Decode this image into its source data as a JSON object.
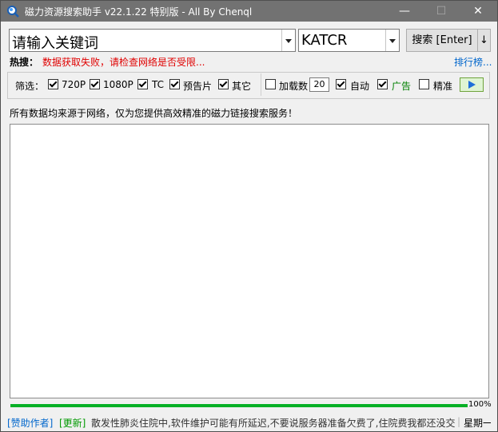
{
  "window": {
    "title": "磁力资源搜索助手 v22.1.22 特别版 - All By Chenql",
    "minimize": "—",
    "maximize": "☐",
    "close": "✕"
  },
  "search": {
    "keyword_placeholder": "请输入关键词",
    "engine": "KATCR",
    "search_button": "搜索 [Enter]",
    "sort_button": "↓"
  },
  "hot": {
    "label": "热搜：",
    "error": "数据获取失败，请检查网络是否受限...",
    "rank_link": "排行榜..."
  },
  "filter": {
    "label": "筛选：",
    "options": [
      {
        "label": "720P",
        "checked": true
      },
      {
        "label": "1080P",
        "checked": true
      },
      {
        "label": "TC",
        "checked": true
      },
      {
        "label": "预告片",
        "checked": true
      },
      {
        "label": "其它",
        "checked": true
      }
    ],
    "load_count_label": "加载数",
    "load_count_checked": false,
    "load_count_value": "20",
    "auto_label": "自动",
    "auto_checked": true,
    "ads_label": "广告",
    "ads_checked": true,
    "ads_color": "#008000",
    "precise_label": "精准",
    "precise_checked": false,
    "play_icon": "play-icon"
  },
  "notice": "所有数据均来源于网络，仅为您提供高效精准的磁力链接搜索服务！",
  "progress": {
    "value": 1.0,
    "text": "100%"
  },
  "status": {
    "support_link": "[赞助作者]",
    "update_link": "[更新]",
    "message": "散发性肺炎住院中,软件维护可能有所延迟,不要说服务器准备欠费了,住院费我都还没交",
    "separator": "|",
    "weekday": "星期一"
  }
}
